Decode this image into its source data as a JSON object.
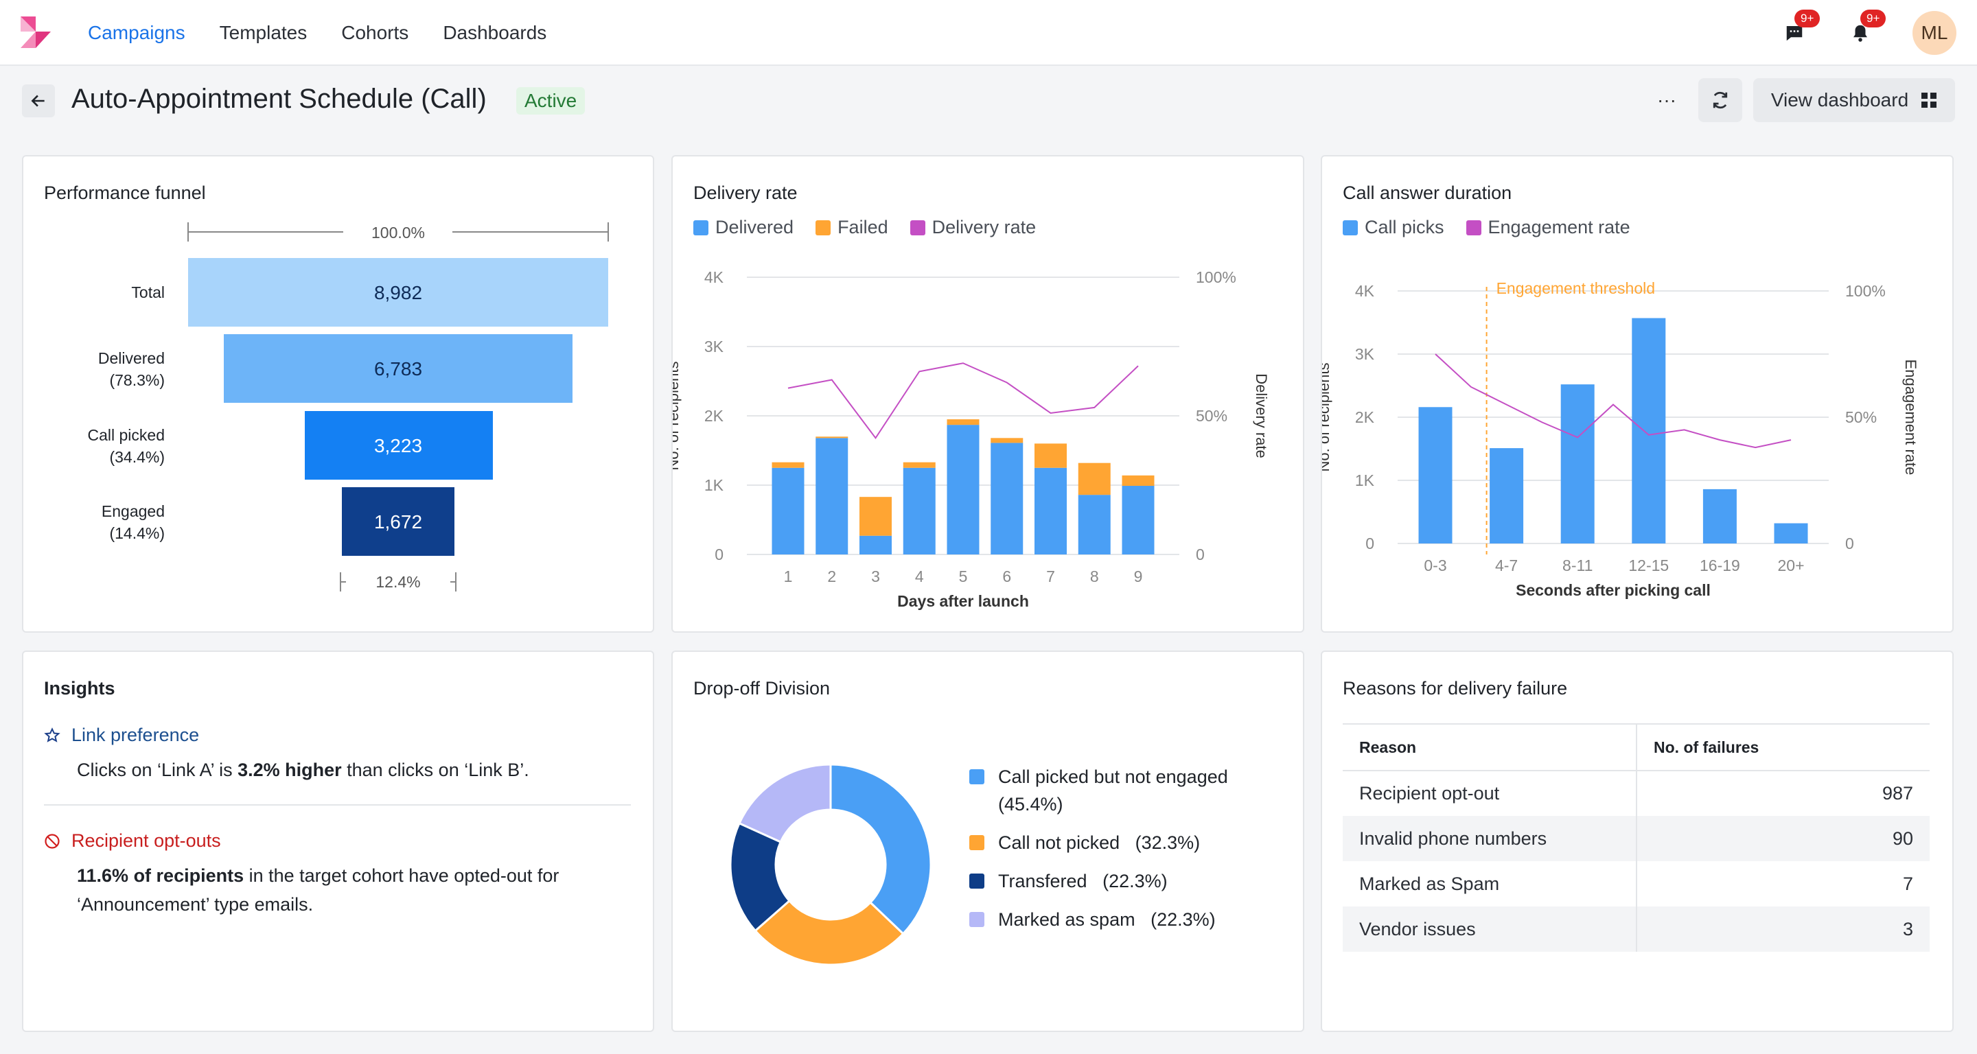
{
  "nav": {
    "items": [
      "Campaigns",
      "Templates",
      "Cohorts",
      "Dashboards"
    ],
    "messages_badge": "9+",
    "notifications_badge": "9+",
    "avatar_initials": "ML"
  },
  "header": {
    "title": "Auto-Appointment Schedule (Call)",
    "status": "Active",
    "more_label": "···",
    "view_dashboard_label": "View dashboard"
  },
  "colors": {
    "accent": "#1a73e8",
    "delivered": "#4a9ff5",
    "failed": "#ffa533",
    "rate_line": "#c44fc4",
    "funnel": [
      "#a8d4fb",
      "#6db4f8",
      "#1480f3",
      "#0f3f8c"
    ],
    "donut": [
      "#4a9ff5",
      "#ffa533",
      "#0e3d87",
      "#b5b8f7"
    ]
  },
  "funnel": {
    "title": "Performance funnel",
    "top_pct": "100.0%",
    "bottom_pct": "12.4%",
    "stages": [
      {
        "label": "Total",
        "sub": "",
        "value": "8,982",
        "count": 8982
      },
      {
        "label": "Delivered",
        "sub": "(78.3%)",
        "value": "6,783",
        "count": 6783
      },
      {
        "label": "Call picked",
        "sub": "(34.4%)",
        "value": "3,223",
        "count": 3223
      },
      {
        "label": "Engaged",
        "sub": "(14.4%)",
        "value": "1,672",
        "count": 1672
      }
    ]
  },
  "delivery": {
    "title": "Delivery rate",
    "legend": [
      "Delivered",
      "Failed",
      "Delivery rate"
    ]
  },
  "answer": {
    "title": "Call answer duration",
    "legend": [
      "Call picks",
      "Engagement rate"
    ]
  },
  "insights": {
    "title": "Insights",
    "items": [
      {
        "heading": "Link preference",
        "text_pre": "Clicks on ‘Link A’ is ",
        "text_bold": "3.2% higher",
        "text_post": " than clicks on ‘Link B’."
      },
      {
        "heading": "Recipient opt-outs",
        "text_pre": "",
        "text_bold": "11.6% of recipients",
        "text_post": " in the target cohort have opted-out for ‘Announcement’ type emails."
      }
    ]
  },
  "dropoff": {
    "title": "Drop-off Division",
    "segments": [
      {
        "label": "Call picked but not engaged",
        "pct": "(45.4%)",
        "value": 45.4
      },
      {
        "label": "Call not picked",
        "pct": "(32.3%)",
        "value": 32.3
      },
      {
        "label": "Transfered",
        "pct": "(22.3%)",
        "value": 22.3
      },
      {
        "label": "Marked as spam",
        "pct": "(22.3%)",
        "value": 22.3
      }
    ]
  },
  "failures": {
    "title": "Reasons for delivery failure",
    "columns": [
      "Reason",
      "No. of failures"
    ],
    "rows": [
      {
        "reason": "Recipient opt-out",
        "count": "987"
      },
      {
        "reason": "Invalid phone numbers",
        "count": "90"
      },
      {
        "reason": "Marked as Spam",
        "count": "7"
      },
      {
        "reason": "Vendor issues",
        "count": "3"
      }
    ]
  },
  "chart_data": [
    {
      "type": "bar",
      "title": "Delivery rate",
      "xlabel": "Days after launch",
      "ylabel": "No. of recipients",
      "y2label": "Delivery rate",
      "categories": [
        "1",
        "2",
        "3",
        "4",
        "5",
        "6",
        "7",
        "8",
        "9"
      ],
      "ylim": [
        0,
        4000
      ],
      "y_ticks": [
        "0",
        "1K",
        "2K",
        "3K",
        "4K"
      ],
      "y2lim": [
        0,
        100
      ],
      "y2_ticks": [
        "0",
        "50%",
        "100%"
      ],
      "stacked": true,
      "series": [
        {
          "name": "Delivered",
          "kind": "bar",
          "axis": "left",
          "values": [
            1250,
            1680,
            270,
            1250,
            1870,
            1610,
            1250,
            860,
            990
          ]
        },
        {
          "name": "Failed",
          "kind": "bar",
          "axis": "left",
          "values": [
            80,
            20,
            560,
            80,
            80,
            70,
            350,
            460,
            150
          ]
        },
        {
          "name": "Delivery rate",
          "kind": "line",
          "axis": "right",
          "values": [
            60,
            63,
            42,
            66,
            69,
            62,
            51,
            53,
            68
          ]
        }
      ],
      "grid": true,
      "legend": "top-left"
    },
    {
      "type": "bar",
      "title": "Call answer duration",
      "xlabel": "Seconds after picking call",
      "ylabel": "No. of recipients",
      "y2label": "Engagement rate",
      "categories": [
        "0-3",
        "4-7",
        "8-11",
        "12-15",
        "16-19",
        "20+"
      ],
      "ylim": [
        0,
        4000
      ],
      "y_ticks": [
        "0",
        "1K",
        "2K",
        "3K",
        "4K"
      ],
      "y2lim": [
        0,
        100
      ],
      "y2_ticks": [
        "0",
        "50%",
        "100%"
      ],
      "annotation": "Engagement threshold",
      "series": [
        {
          "name": "Call picks",
          "kind": "bar",
          "axis": "left",
          "values": [
            2160,
            1510,
            2520,
            3570,
            860,
            320
          ]
        },
        {
          "name": "Engagement rate",
          "kind": "line",
          "axis": "right",
          "x": [
            0,
            0.5,
            1,
            1.5,
            2,
            2.5,
            3,
            3.5,
            4,
            4.5,
            5
          ],
          "values": [
            75,
            62,
            55,
            48,
            42,
            55,
            43,
            45,
            41,
            38,
            41
          ]
        }
      ],
      "grid": true,
      "legend": "top-left"
    },
    {
      "type": "pie",
      "title": "Drop-off Division",
      "categories": [
        "Call picked but not engaged",
        "Call not picked",
        "Transfered",
        "Marked as spam"
      ],
      "values": [
        45.4,
        32.3,
        22.3,
        22.3
      ]
    }
  ]
}
